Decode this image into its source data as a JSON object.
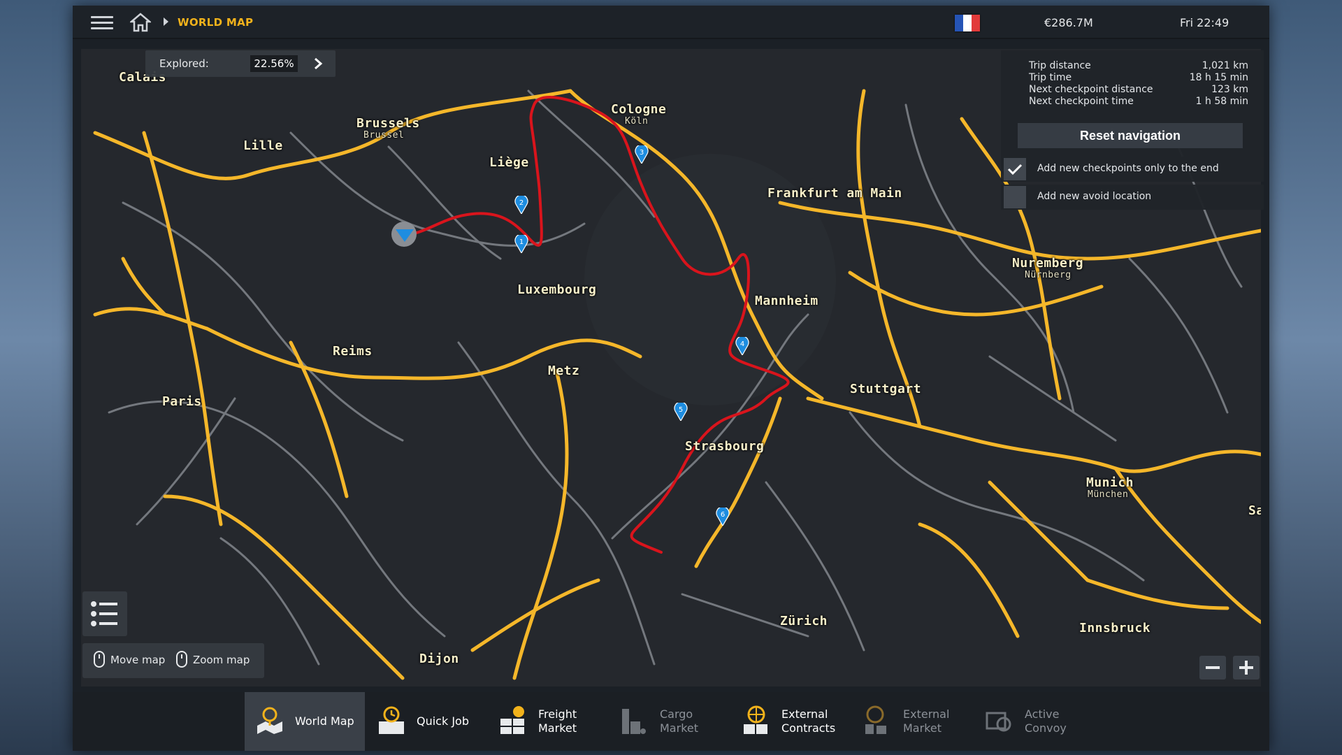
{
  "header": {
    "breadcrumb": "WORLD MAP",
    "money": "€286.7M",
    "clock": "Fri 22:49",
    "flag_colors": [
      "#2554b5",
      "#ffffff",
      "#e23a3a"
    ]
  },
  "explored": {
    "label": "Explored:",
    "value": "22.56%"
  },
  "navigation": {
    "rows": [
      {
        "label": "Trip distance",
        "value": "1,021 km"
      },
      {
        "label": "Trip time",
        "value": "18 h 15 min"
      },
      {
        "label": "Next checkpoint distance",
        "value": "123 km"
      },
      {
        "label": "Next checkpoint time",
        "value": "1 h 58 min"
      }
    ],
    "reset_label": "Reset navigation",
    "option_checkpoints": {
      "label": "Add new checkpoints only to the end",
      "checked": true
    },
    "option_avoid": {
      "label": "Add new avoid location",
      "checked": false
    }
  },
  "map": {
    "cities": [
      {
        "name": "Calais"
      },
      {
        "name": "Brussels"
      },
      {
        "name": "Brussel"
      },
      {
        "name": "Lille"
      },
      {
        "name": "Liège"
      },
      {
        "name": "Cologne"
      },
      {
        "name": "Köln"
      },
      {
        "name": "Frankfurt am Main"
      },
      {
        "name": "Nuremberg"
      },
      {
        "name": "Nürnberg"
      },
      {
        "name": "Luxembourg"
      },
      {
        "name": "Mannheim"
      },
      {
        "name": "Reims"
      },
      {
        "name": "Metz"
      },
      {
        "name": "Paris"
      },
      {
        "name": "Stuttgart"
      },
      {
        "name": "Strasbourg"
      },
      {
        "name": "Munich"
      },
      {
        "name": "München"
      },
      {
        "name": "Zürich"
      },
      {
        "name": "Innsbruck"
      },
      {
        "name": "Dijon"
      },
      {
        "name": "Sa"
      }
    ],
    "route_color": "#d9141c",
    "highway_color": "#f5b72a",
    "road_color": "#7b7f85",
    "checkpoints": [
      "1",
      "2",
      "3",
      "4",
      "5",
      "6"
    ]
  },
  "hints": {
    "move": "Move map",
    "zoom": "Zoom map"
  },
  "tabs": [
    {
      "line1": "World Map",
      "line2": "",
      "icon": "world-map-icon"
    },
    {
      "line1": "Quick Job",
      "line2": "",
      "icon": "quick-job-icon"
    },
    {
      "line1": "Freight",
      "line2": "Market",
      "icon": "freight-market-icon"
    },
    {
      "line1": "Cargo",
      "line2": "Market",
      "icon": "cargo-market-icon"
    },
    {
      "line1": "External",
      "line2": "Contracts",
      "icon": "external-contracts-icon"
    },
    {
      "line1": "External",
      "line2": "Market",
      "icon": "external-market-icon"
    },
    {
      "line1": "Active",
      "line2": "Convoy",
      "icon": "active-convoy-icon"
    }
  ]
}
